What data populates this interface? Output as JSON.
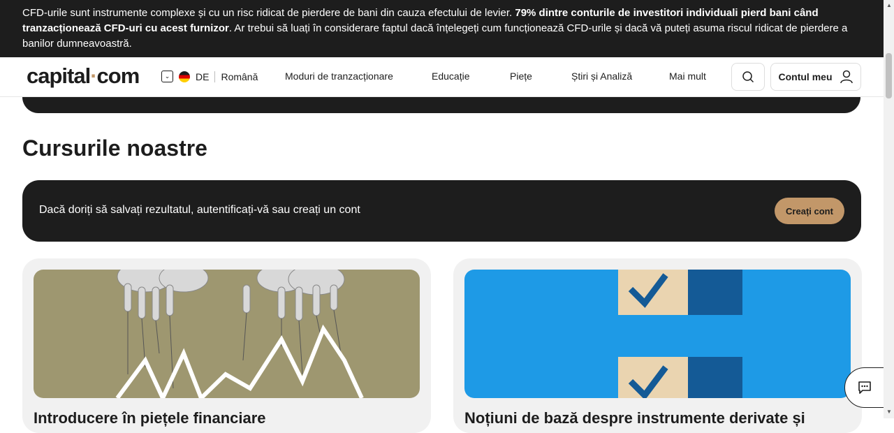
{
  "warning": {
    "part1": "CFD-urile sunt instrumente complexe și cu un risc ridicat de pierdere de bani din cauza efectului de levier. ",
    "bold": "79% dintre conturile de investitori individuali pierd bani când tranzacționează CFD-uri cu acest furnizor",
    "part2": ". Ar trebui să luați în considerare faptul dacă înțelegeți cum funcționează CFD-urile și dacă vă puteți asuma riscul ridicat de pierdere a banilor dumneavoastră."
  },
  "header": {
    "logo_left": "capital",
    "logo_dot": "·",
    "logo_right": "com",
    "country": "DE",
    "language": "Română",
    "nav": [
      "Moduri de tranzacționare",
      "Educație",
      "Piețe",
      "Știri și Analiză",
      "Mai mult"
    ],
    "account_label": "Contul meu"
  },
  "main": {
    "section_title": "Cursurile noastre",
    "login_text": "Dacă doriți să salvați rezultatul, autentificați-vă sau creați un cont",
    "create_label": "Creați cont",
    "cards": [
      {
        "title": "Introducere în piețele financiare"
      },
      {
        "title": "Noțiuni de bază despre instrumente derivate și"
      }
    ]
  },
  "colors": {
    "dark": "#1d1d1d",
    "accent": "#c29769",
    "blue": "#1e9ae6",
    "olive": "#9e9770"
  }
}
